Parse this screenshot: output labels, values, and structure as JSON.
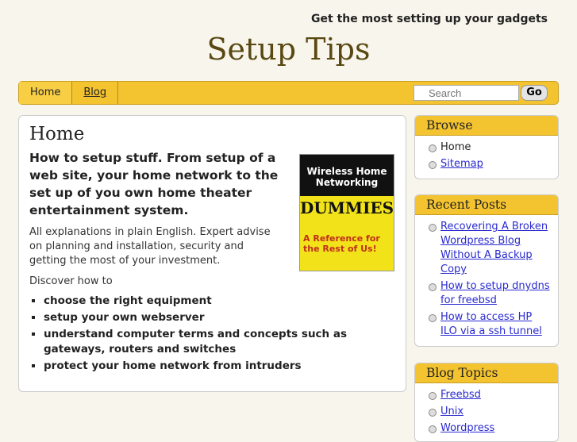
{
  "header": {
    "tagline": "Get the most setting up your gadgets",
    "title": "Setup Tips"
  },
  "nav": {
    "items": [
      "Home",
      "Blog"
    ],
    "search_placeholder": "Search",
    "go": "Go"
  },
  "main": {
    "heading": "Home",
    "lead": "How to setup stuff. From setup of a web site, your home network  to the set up of you own home theater entertainment system.",
    "para": "All explanations in plain English. Expert advise on planning and installation, security and getting the most of your investment.",
    "discover": "Discover how to",
    "bullets": [
      "choose the right equipment",
      "setup your own webserver",
      "understand computer terms and concepts such as gateways, routers and switches",
      "protect your home network from intruders"
    ],
    "book": {
      "title": "Wireless Home Networking",
      "brand": "DUMMIES",
      "for": "FOR",
      "tag": "A Reference for the Rest of Us!"
    }
  },
  "sidebar": {
    "browse": {
      "title": "Browse",
      "items": [
        "Home",
        "Sitemap"
      ]
    },
    "recent": {
      "title": "Recent Posts",
      "items": [
        "Recovering A Broken Wordpress Blog Without A Backup Copy",
        "How to setup dnydns for freebsd",
        "How to access HP ILO via a ssh tunnel"
      ]
    },
    "topics": {
      "title": "Blog Topics",
      "items": [
        "Freebsd",
        "Unix",
        "Wordpress"
      ]
    }
  }
}
